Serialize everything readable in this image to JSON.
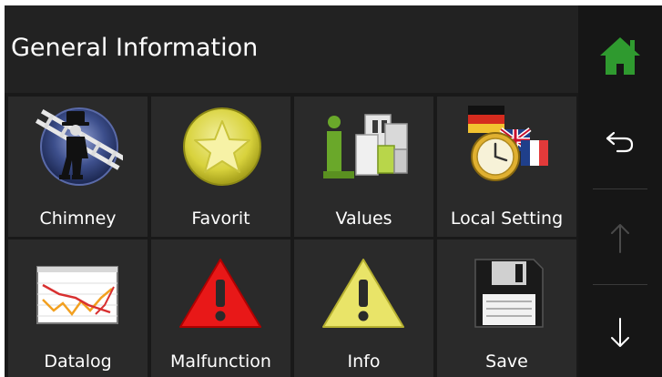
{
  "header": {
    "title": "General Information"
  },
  "tiles": [
    {
      "label": "Chimney",
      "icon": "chimney-sweep-icon"
    },
    {
      "label": "Favorit",
      "icon": "star-icon"
    },
    {
      "label": "Values",
      "icon": "values-icon"
    },
    {
      "label": "Local Setting",
      "icon": "local-setting-icon"
    },
    {
      "label": "Datalog",
      "icon": "datalog-chart-icon"
    },
    {
      "label": "Malfunction",
      "icon": "malfunction-warning-icon"
    },
    {
      "label": "Info",
      "icon": "info-warning-icon"
    },
    {
      "label": "Save",
      "icon": "floppy-disk-icon"
    }
  ],
  "sidebar": {
    "home": {
      "icon": "home-icon",
      "color": "#2f9a2f"
    },
    "back": {
      "icon": "back-arrow-icon",
      "state": "enabled"
    },
    "up": {
      "icon": "arrow-up-icon",
      "state": "disabled"
    },
    "down": {
      "icon": "arrow-down-icon",
      "state": "enabled"
    }
  },
  "colors": {
    "background": "#191919",
    "tile": "#2a2a2a",
    "text": "#ffffff",
    "accent_green": "#2f9a2f"
  }
}
